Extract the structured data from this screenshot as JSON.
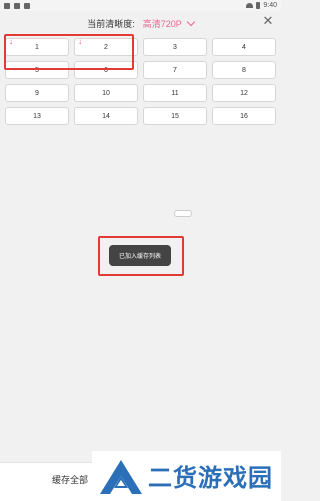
{
  "header": {
    "label": "当前清晰度:",
    "quality": "高清720P"
  },
  "episodes": [
    "1",
    "2",
    "3",
    "4",
    "5",
    "6",
    "7",
    "8",
    "9",
    "10",
    "11",
    "12",
    "13",
    "14",
    "15",
    "16"
  ],
  "downloaded_marker": "↓",
  "toast": "已加入缓存列表",
  "bottom": {
    "cache_all": "缓存全部"
  },
  "watermark": {
    "text": "二货游戏园"
  },
  "statusbar": {
    "time": "9:40"
  },
  "colors": {
    "accent": "#f06292",
    "highlight": "#e53935",
    "watermark": "#2b6fb8"
  },
  "icons": {
    "close": "close-icon",
    "chevron": "chevron-down-icon",
    "download": "download-arrow-icon"
  }
}
